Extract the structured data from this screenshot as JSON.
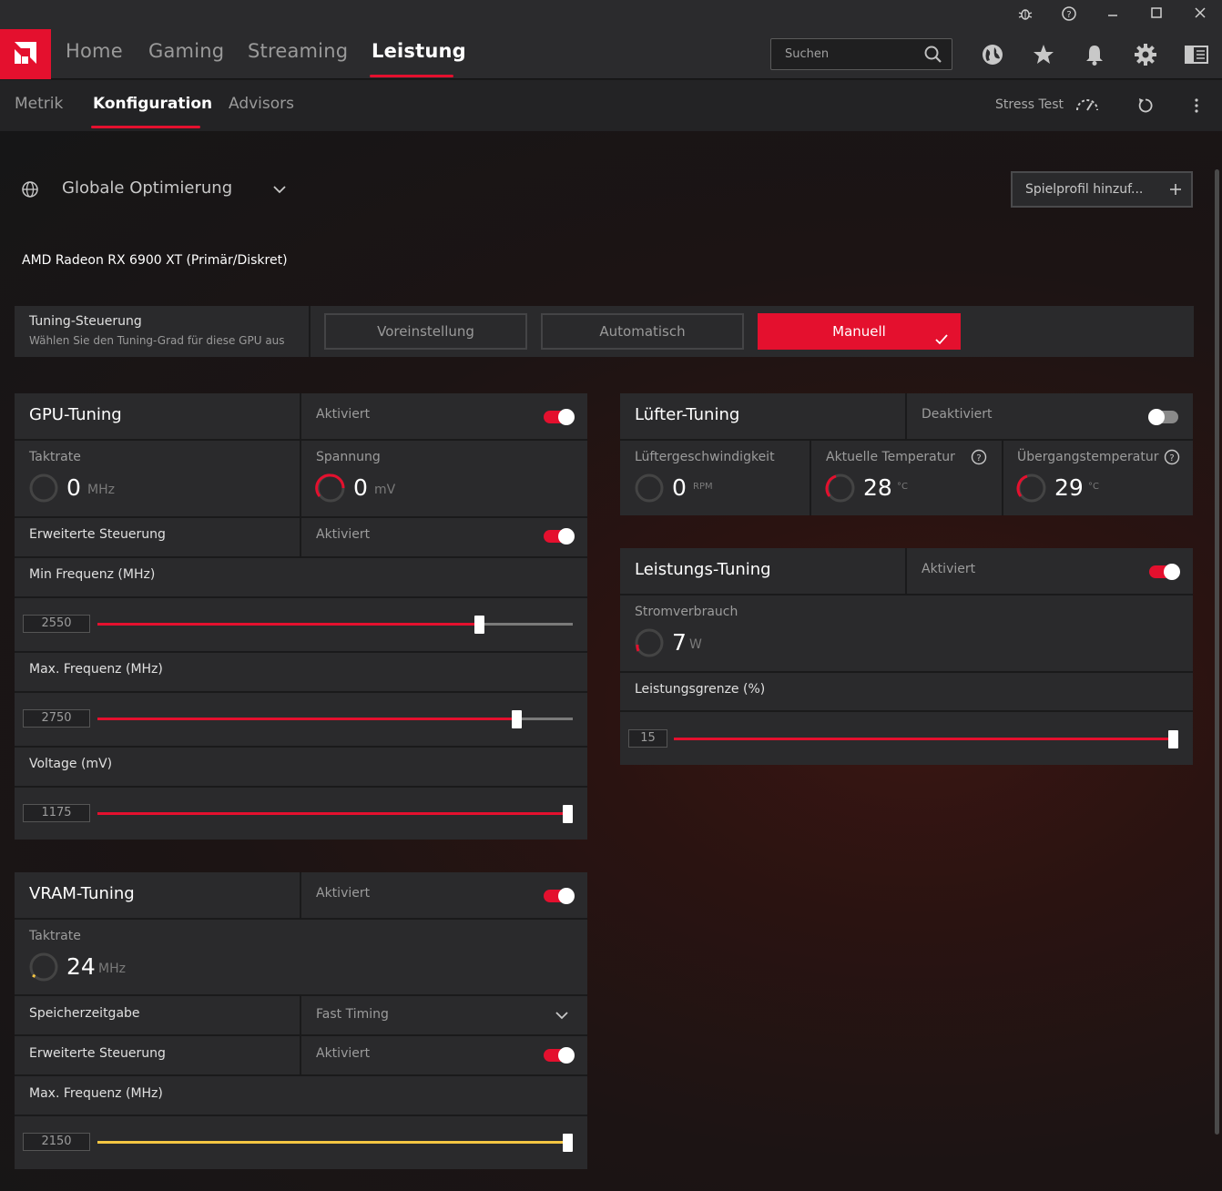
{
  "titlebar": {
    "bug": "bug-icon",
    "help": "help-icon",
    "minimize": "minimize-icon",
    "maximize": "maximize-icon",
    "close": "close-icon"
  },
  "nav": {
    "items": [
      "Home",
      "Gaming",
      "Streaming",
      "Leistung"
    ],
    "active": "Leistung",
    "search_placeholder": "Suchen"
  },
  "subnav": {
    "items": [
      "Metrik",
      "Konfiguration",
      "Advisors"
    ],
    "active": "Konfiguration",
    "stress_test": "Stress Test"
  },
  "profile": {
    "name": "Globale Optimierung",
    "add_profile": "Spielprofil hinzuf..."
  },
  "gpu_name": "AMD Radeon RX 6900 XT (Primär/Diskret)",
  "tuning_control": {
    "title": "Tuning-Steuerung",
    "subtitle": "Wählen Sie den Tuning-Grad für diese GPU aus",
    "options": [
      "Voreinstellung",
      "Automatisch",
      "Manuell"
    ],
    "selected": "Manuell"
  },
  "gpu_tuning": {
    "title": "GPU-Tuning",
    "status": "Aktiviert",
    "clock_label": "Taktrate",
    "clock_value": "0",
    "clock_unit": "MHz",
    "voltage_label": "Spannung",
    "voltage_value": "0",
    "voltage_unit": "mV",
    "advanced_label": "Erweiterte Steuerung",
    "advanced_status": "Aktiviert",
    "min_freq_label": "Min Frequenz (MHz)",
    "min_freq_value": "2550",
    "min_freq_fraction": 0.81,
    "max_freq_label": "Max. Frequenz (MHz)",
    "max_freq_value": "2750",
    "max_freq_fraction": 0.89,
    "voltage_mv_label": "Voltage (mV)",
    "voltage_mv_value": "1175",
    "voltage_mv_fraction": 1.0
  },
  "vram_tuning": {
    "title": "VRAM-Tuning",
    "status": "Aktiviert",
    "clock_label": "Taktrate",
    "clock_value": "24",
    "clock_unit": "MHz",
    "timing_label": "Speicherzeitgabe",
    "timing_value": "Fast Timing",
    "advanced_label": "Erweiterte Steuerung",
    "advanced_status": "Aktiviert",
    "max_freq_label": "Max. Frequenz (MHz)",
    "max_freq_value": "2150",
    "max_freq_fraction": 1.0
  },
  "fan_tuning": {
    "title": "Lüfter-Tuning",
    "status": "Deaktiviert",
    "speed_label": "Lüftergeschwindigkeit",
    "speed_value": "0",
    "speed_unit": "RPM",
    "temp_label": "Aktuelle Temperatur",
    "temp_value": "28",
    "temp_unit": "°C",
    "junction_label": "Übergangstemperatur",
    "junction_value": "29",
    "junction_unit": "°C"
  },
  "power_tuning": {
    "title": "Leistungs-Tuning",
    "status": "Aktiviert",
    "power_label": "Stromverbrauch",
    "power_value": "7",
    "power_unit": "W",
    "limit_label": "Leistungsgrenze (%)",
    "limit_value": "15",
    "limit_fraction": 1.0
  },
  "colors": {
    "accent": "#e4102e",
    "vram_accent": "#f4c542"
  }
}
